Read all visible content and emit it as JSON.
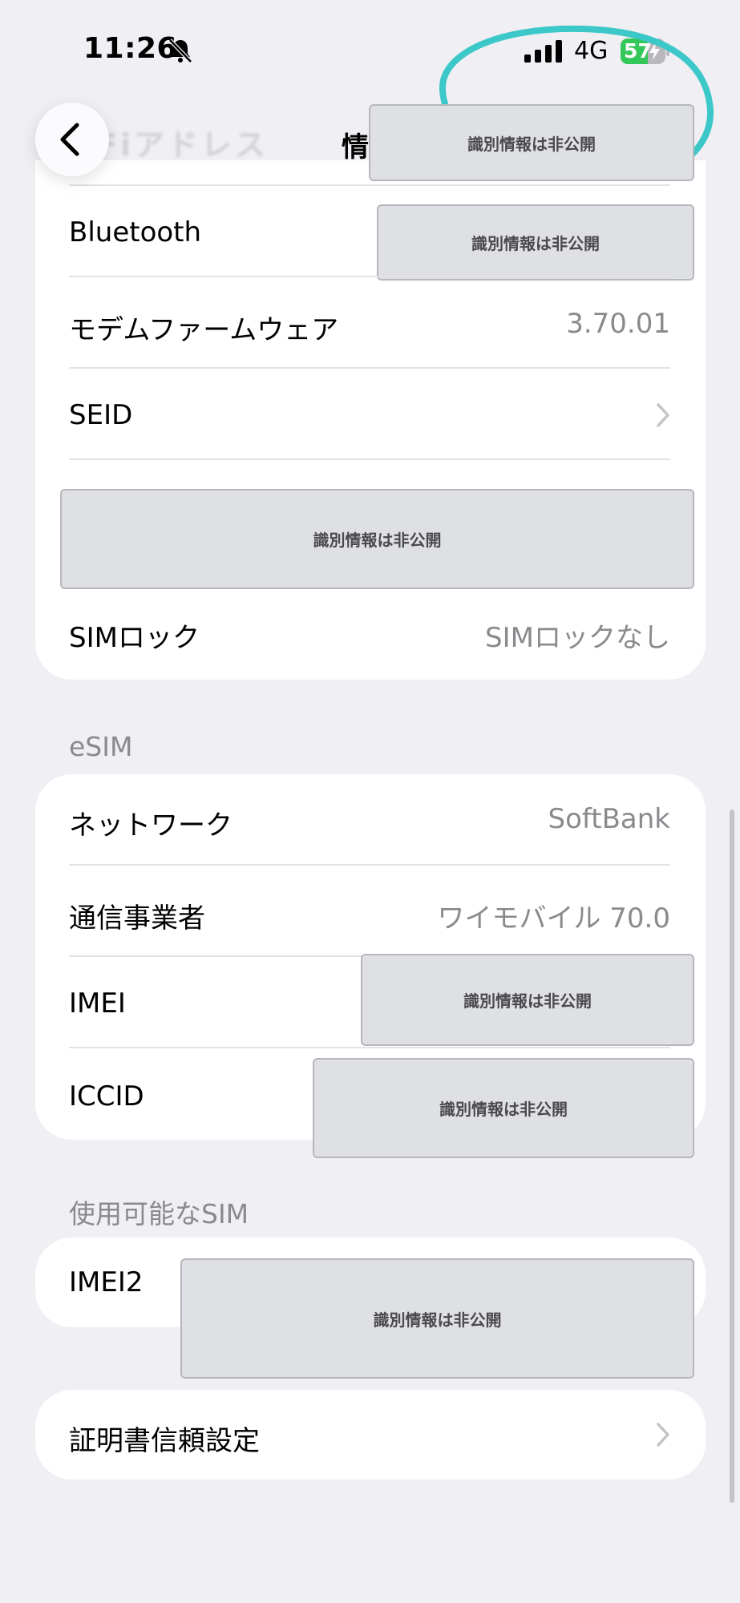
{
  "status_bar": {
    "time": "11:26",
    "network_type": "4G",
    "battery": "57"
  },
  "nav": {
    "title_partial": "情",
    "background_row_text": "Fiアドレス"
  },
  "redacted_label": "識別情報は非公開",
  "device_section": {
    "bluetooth_label": "Bluetooth",
    "modem_label": "モデムファームウェア",
    "modem_value": "3.70.01",
    "seid_label": "SEID",
    "simlock_label": "SIMロック",
    "simlock_value": "SIMロックなし"
  },
  "esim_section": {
    "header": "eSIM",
    "network_label": "ネットワーク",
    "network_value": "SoftBank",
    "carrier_label": "通信事業者",
    "carrier_value": "ワイモバイル 70.0",
    "imei_label": "IMEI",
    "iccid_label": "ICCID"
  },
  "available_sim_section": {
    "header": "使用可能なSIM",
    "imei2_label": "IMEI2"
  },
  "cert_trust": {
    "label": "証明書信頼設定"
  },
  "colors": {
    "annotation": "#3cc8c8",
    "battery_green": "#34c759",
    "background": "#efeff4"
  },
  "icons": [
    "bell-slash-icon",
    "cellular-signal-icon",
    "battery-charging-icon",
    "chevron-left-icon",
    "chevron-right-icon"
  ]
}
